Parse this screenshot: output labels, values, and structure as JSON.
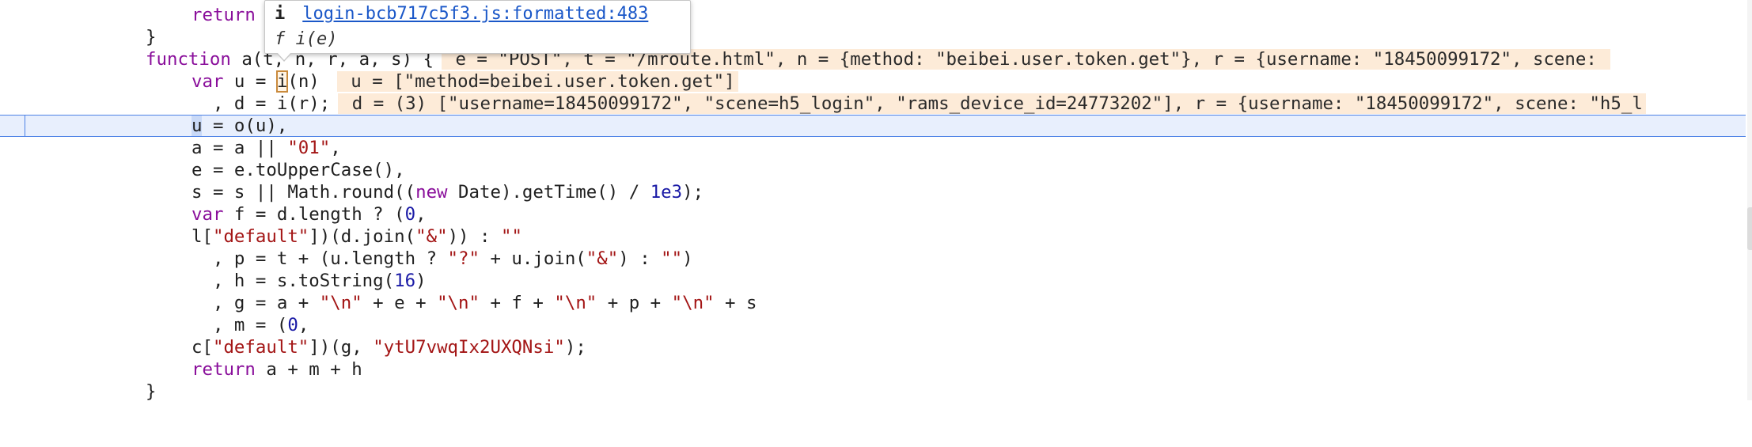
{
  "popover": {
    "info_glyph": "i",
    "location_link": "login-bcb717c5f3.js:formatted:483",
    "fn_glyph": "f",
    "signature": "i(e)"
  },
  "code": {
    "l1_kw": "return",
    "l2_text": "}",
    "l3_kw": "function",
    "l3_name": " a(",
    "l3_params_hidden": "t, n, r, a, s) {",
    "l3_inline": " e = \"POST\", t = \"/mroute.html\", n = {method: \"beibei.user.token.get\"}, r = {username: \"18450099172\", scene: ",
    "l4_kw": "var",
    "l4_pre": " u = ",
    "l4_i": "i",
    "l4_post": "(n)",
    "l4_inline": " u = [\"method=beibei.user.token.get\"]",
    "l5_text": "  , d = i(r);",
    "l5_inline": " d = (3) [\"username=18450099172\", \"scene=h5_login\", \"rams_device_id=24773202\"], r = {username: \"18450099172\", scene: \"h5_l",
    "l6_u": "u",
    "l6_rest": " = o(u),",
    "l7_pre": "a = a || ",
    "l7_str": "\"01\"",
    "l7_post": ",",
    "l8_text": "e = e.toUpperCase(),",
    "l9_pre": "s = s || Math.round((",
    "l9_kw": "new",
    "l9_mid": " Date).getTime() / ",
    "l9_num": "1e3",
    "l9_post": ");",
    "l10_kw": "var",
    "l10_pre": " f = d.length ? (",
    "l10_num": "0",
    "l10_post": ",",
    "l11_pre": "l[",
    "l11_str1": "\"default\"",
    "l11_mid": "])(d.join(",
    "l11_str2": "\"&\"",
    "l11_mid2": ")) : ",
    "l11_str3": "\"\"",
    "l12_pre": "  , p = t + (u.length ? ",
    "l12_str1": "\"?\"",
    "l12_mid": " + u.join(",
    "l12_str2": "\"&\"",
    "l12_mid2": ") : ",
    "l12_str3": "\"\"",
    "l12_post": ")",
    "l13_pre": "  , h = s.toString(",
    "l13_num": "16",
    "l13_post": ")",
    "l14_pre": "  , g = a + ",
    "l14_s1": "\"\\n\"",
    "l14_m1": " + e + ",
    "l14_s2": "\"\\n\"",
    "l14_m2": " + f + ",
    "l14_s3": "\"\\n\"",
    "l14_m3": " + p + ",
    "l14_s4": "\"\\n\"",
    "l14_post": " + s",
    "l15_pre": "  , m = (",
    "l15_num": "0",
    "l15_post": ",",
    "l16_pre": "c[",
    "l16_str1": "\"default\"",
    "l16_mid": "])(g, ",
    "l16_str2": "\"ytU7vwqIx2UXQNsi\"",
    "l16_post": ");",
    "l17_kw": "return",
    "l17_rest": " a + m + h",
    "l18_text": "}"
  },
  "colors": {
    "keyword": "#8a0f9b",
    "string": "#a31515",
    "number": "#1a1aa6",
    "current_line": "#e8effd",
    "inline_value_bg": "#fdebd8",
    "link": "#1a57c8"
  }
}
